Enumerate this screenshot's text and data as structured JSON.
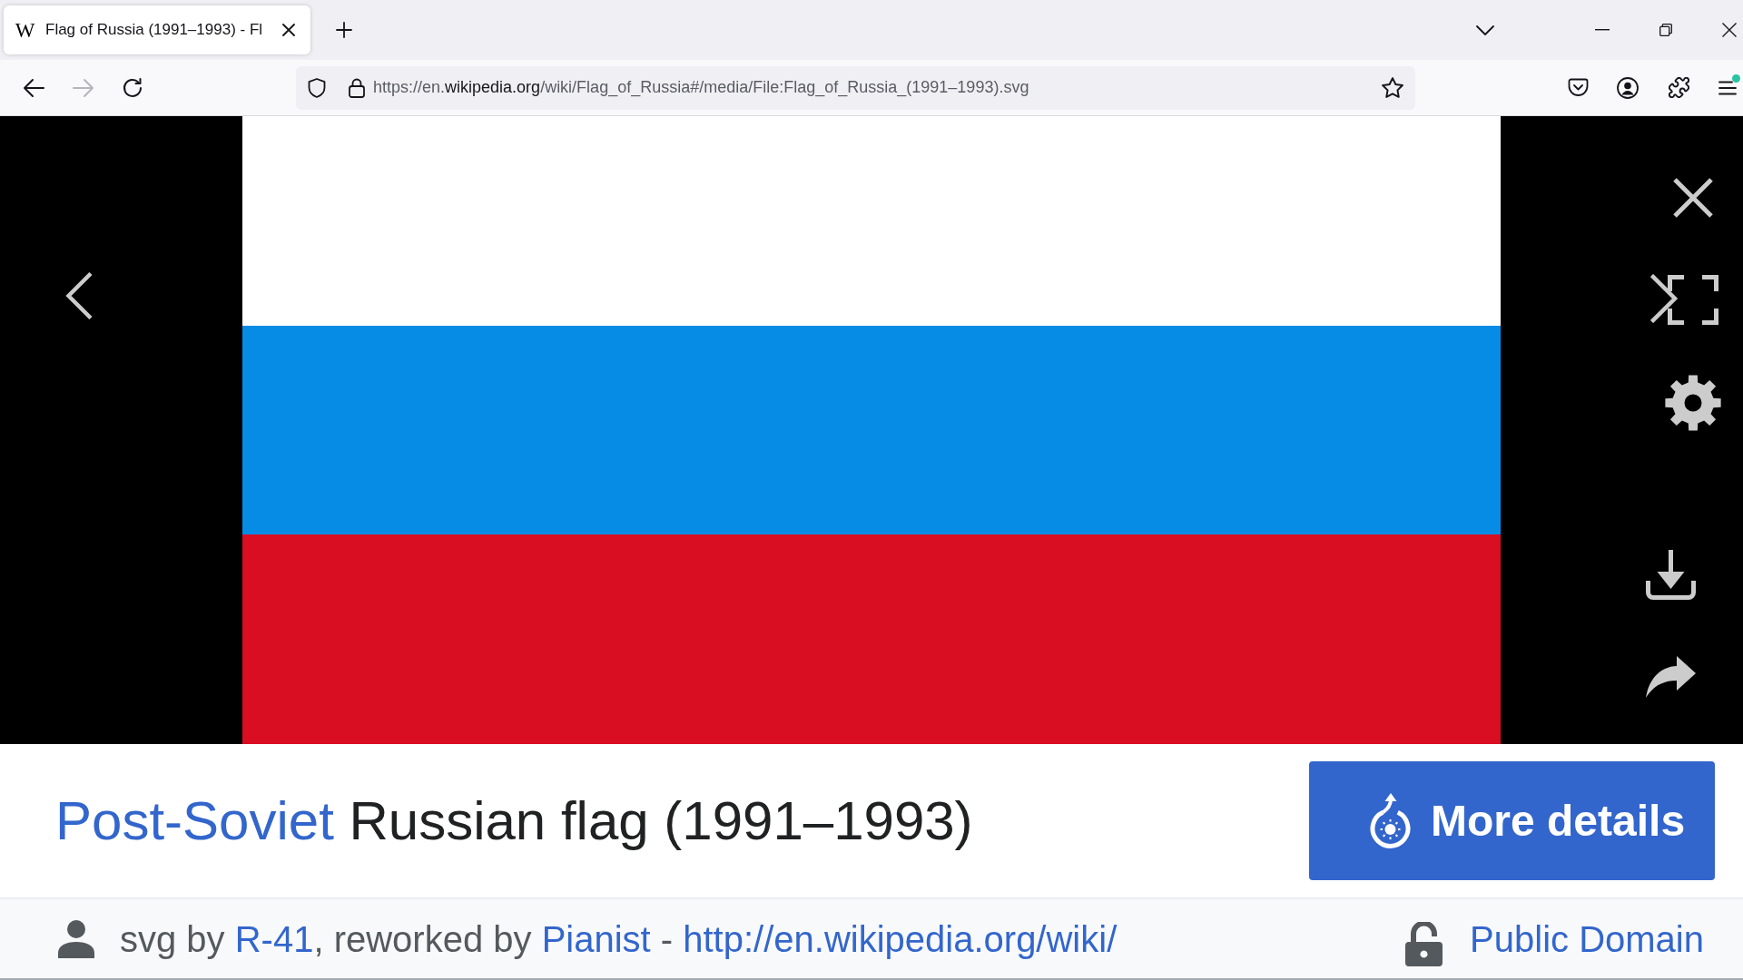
{
  "browser": {
    "tab": {
      "favicon": "W",
      "title": "Flag of Russia (1991–1993) - Fl",
      "selected": true
    },
    "back": {
      "disabled": false
    },
    "forward": {
      "disabled": true
    },
    "address": {
      "parts": [
        {
          "text": "https://en.",
          "emphasis": false
        },
        {
          "text": "wikipedia.org",
          "emphasis": true
        },
        {
          "text": "/wiki/Flag_of_Russia#/media/File:Flag_of_Russia_(1991–1993).svg",
          "emphasis": false
        }
      ]
    },
    "app_menu": {
      "notification": true
    }
  },
  "caption": {
    "parts": [
      {
        "kind": "link",
        "text": "Post-Soviet"
      },
      {
        "kind": "text",
        "text": " Russian flag (1991–1993)"
      }
    ]
  },
  "details_button": {
    "label": "More details"
  },
  "attribution": {
    "parts": [
      {
        "kind": "text",
        "text": "svg by "
      },
      {
        "kind": "link",
        "text": "R-41"
      },
      {
        "kind": "text",
        "text": ", reworked by "
      },
      {
        "kind": "link",
        "text": "Pianist"
      },
      {
        "kind": "text",
        "text": " - "
      },
      {
        "kind": "link",
        "text": "http://en.wikipedia.org/wiki/"
      }
    ]
  },
  "license": {
    "label": "Public Domain"
  }
}
